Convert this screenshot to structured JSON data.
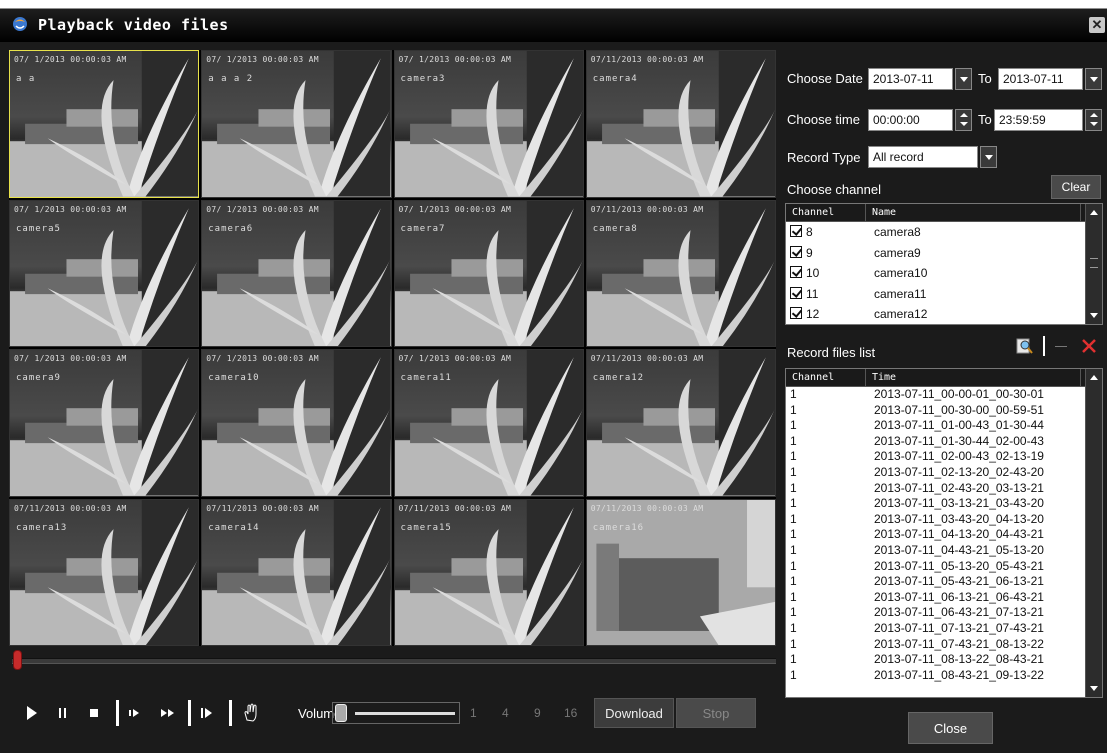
{
  "window": {
    "title": "Playback video files",
    "close_glyph": "✕"
  },
  "tiles": [
    {
      "ts": "07/ 1/2013 00:00:03 AM",
      "cam": "a   a"
    },
    {
      "ts": "07/ 1/2013 00:00:03 AM",
      "cam": "a  a  a  2"
    },
    {
      "ts": "07/ 1/2013 00:00:03 AM",
      "cam": "camera3"
    },
    {
      "ts": "07/11/2013 00:00:03 AM",
      "cam": "camera4"
    },
    {
      "ts": "07/ 1/2013 00:00:03 AM",
      "cam": "camera5"
    },
    {
      "ts": "07/ 1/2013 00:00:03 AM",
      "cam": "camera6"
    },
    {
      "ts": "07/ 1/2013 00:00:03 AM",
      "cam": "camera7"
    },
    {
      "ts": "07/11/2013 00:00:03 AM",
      "cam": "camera8"
    },
    {
      "ts": "07/ 1/2013 00:00:03 AM",
      "cam": "camera9"
    },
    {
      "ts": "07/ 1/2013 00:00:03 AM",
      "cam": "camera10"
    },
    {
      "ts": "07/ 1/2013 00:00:03 AM",
      "cam": "camera11"
    },
    {
      "ts": "07/11/2013 00:00:03 AM",
      "cam": "camera12"
    },
    {
      "ts": "07/11/2013 00:00:03 AM",
      "cam": "camera13"
    },
    {
      "ts": "07/11/2013 00:00:03 AM",
      "cam": "camera14"
    },
    {
      "ts": "07/11/2013 00:00:03 AM",
      "cam": "camera15"
    },
    {
      "ts": "07/11/2013 00:00:03 AM",
      "cam": "camera16"
    }
  ],
  "controls": {
    "volume_label": "Volume",
    "split_options": [
      "1",
      "4",
      "9",
      "16"
    ],
    "download_label": "Download",
    "stop_label": "Stop"
  },
  "filters": {
    "date_label": "Choose Date",
    "date_from": "2013-07-11",
    "to_label": "To",
    "date_to": "2013-07-11",
    "time_label": "Choose time",
    "time_from": "00:00:00",
    "time_to": "23:59:59",
    "record_type_label": "Record Type",
    "record_type": "All record"
  },
  "channels": {
    "label": "Choose channel",
    "clear_label": "Clear",
    "headers": [
      "Channel",
      "Name"
    ],
    "rows": [
      {
        "channel": "8",
        "name": "camera8",
        "checked": true
      },
      {
        "channel": "9",
        "name": "camera9",
        "checked": true
      },
      {
        "channel": "10",
        "name": "camera10",
        "checked": true
      },
      {
        "channel": "11",
        "name": "camera11",
        "checked": true
      },
      {
        "channel": "12",
        "name": "camera12",
        "checked": true
      }
    ]
  },
  "records": {
    "label": "Record files list",
    "headers": [
      "Channel",
      "Time"
    ],
    "rows": [
      {
        "channel": "1",
        "time": "2013-07-11_00-00-01_00-30-01"
      },
      {
        "channel": "1",
        "time": "2013-07-11_00-30-00_00-59-51"
      },
      {
        "channel": "1",
        "time": "2013-07-11_01-00-43_01-30-44"
      },
      {
        "channel": "1",
        "time": "2013-07-11_01-30-44_02-00-43"
      },
      {
        "channel": "1",
        "time": "2013-07-11_02-00-43_02-13-19"
      },
      {
        "channel": "1",
        "time": "2013-07-11_02-13-20_02-43-20"
      },
      {
        "channel": "1",
        "time": "2013-07-11_02-43-20_03-13-21"
      },
      {
        "channel": "1",
        "time": "2013-07-11_03-13-21_03-43-20"
      },
      {
        "channel": "1",
        "time": "2013-07-11_03-43-20_04-13-20"
      },
      {
        "channel": "1",
        "time": "2013-07-11_04-13-20_04-43-21"
      },
      {
        "channel": "1",
        "time": "2013-07-11_04-43-21_05-13-20"
      },
      {
        "channel": "1",
        "time": "2013-07-11_05-13-20_05-43-21"
      },
      {
        "channel": "1",
        "time": "2013-07-11_05-43-21_06-13-21"
      },
      {
        "channel": "1",
        "time": "2013-07-11_06-13-21_06-43-21"
      },
      {
        "channel": "1",
        "time": "2013-07-11_06-43-21_07-13-21"
      },
      {
        "channel": "1",
        "time": "2013-07-11_07-13-21_07-43-21"
      },
      {
        "channel": "1",
        "time": "2013-07-11_07-43-21_08-13-22"
      },
      {
        "channel": "1",
        "time": "2013-07-11_08-13-22_08-43-21"
      },
      {
        "channel": "1",
        "time": "2013-07-11_08-43-21_09-13-22"
      }
    ]
  },
  "footer": {
    "close_label": "Close"
  },
  "colors": {
    "selected_tile": "#e8e24a",
    "seek_knob": "#c62b2b",
    "delete_icon": "#e03030"
  }
}
